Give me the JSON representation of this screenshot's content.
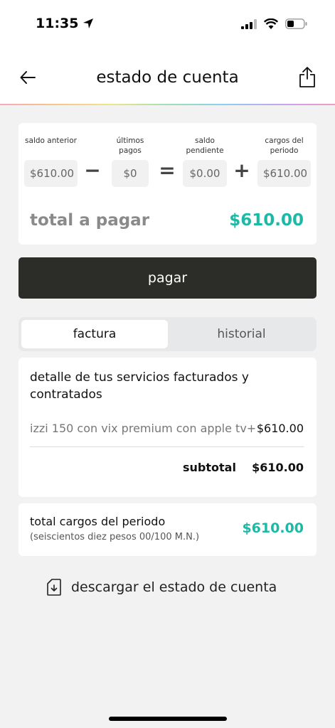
{
  "status_bar": {
    "time": "11:35"
  },
  "header": {
    "title": "estado de cuenta"
  },
  "summary": {
    "items": [
      {
        "label": "saldo anterior",
        "value": "$610.00"
      },
      {
        "label": "últimos pagos",
        "value": "$0"
      },
      {
        "label": "saldo pendiente",
        "value": "$0.00"
      },
      {
        "label": "cargos del periodo",
        "value": "$610.00"
      }
    ],
    "operators": [
      "−",
      "=",
      "+"
    ],
    "total_label": "total a pagar",
    "total_value": "$610.00"
  },
  "pay_button": {
    "label": "pagar"
  },
  "tabs": [
    {
      "label": "factura",
      "active": true
    },
    {
      "label": "historial",
      "active": false
    }
  ],
  "detail": {
    "title": "detalle de tus servicios facturados y contratados",
    "service": {
      "name": "izzi 150 con vix premium con apple tv+",
      "price": "$610.00"
    },
    "subtotal_label": "subtotal",
    "subtotal_value": "$610.00"
  },
  "charges": {
    "label": "total cargos del periodo",
    "words": "(seiscientos diez pesos 00/100 M.N.)",
    "value": "$610.00"
  },
  "download": {
    "label": "descargar el estado de cuenta"
  },
  "colors": {
    "accent": "#1bb9a6",
    "button": "#2c2c28",
    "background": "#f2f2f2"
  },
  "icons": [
    "location-arrow-icon",
    "signal-icon",
    "wifi-icon",
    "battery-icon",
    "back-arrow-icon",
    "share-icon",
    "download-document-icon"
  ]
}
